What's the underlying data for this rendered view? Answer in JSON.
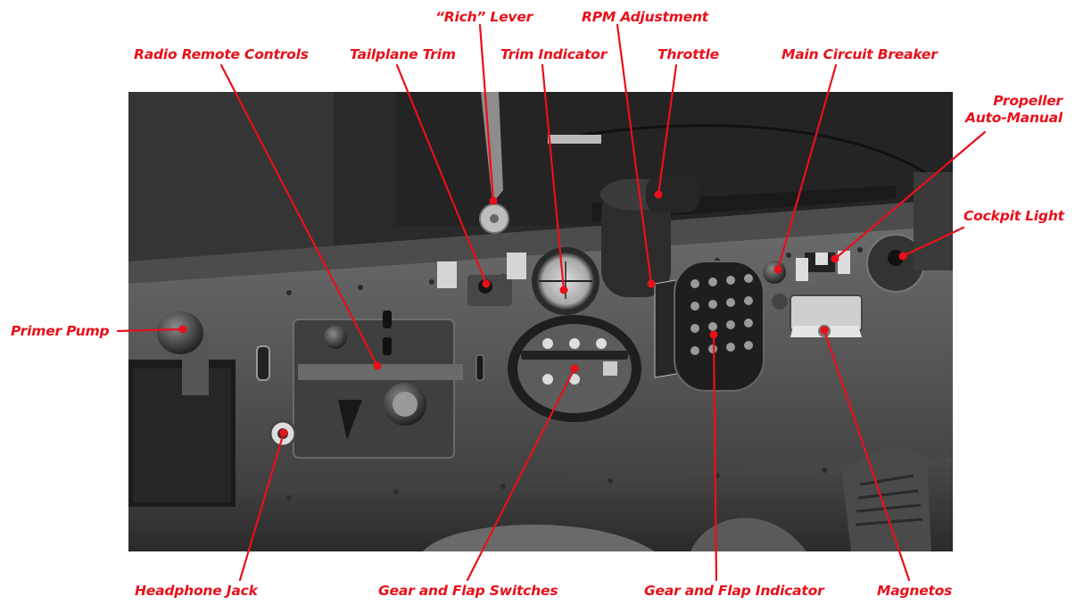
{
  "labels": {
    "rich_lever": "“Rich” Lever",
    "rpm_adjustment": "RPM Adjustment",
    "radio_remote_controls": "Radio Remote Controls",
    "tailplane_trim": "Tailplane Trim",
    "trim_indicator": "Trim Indicator",
    "throttle": "Throttle",
    "main_circuit_breaker": "Main Circuit Breaker",
    "propeller_line1": "Propeller",
    "propeller_line2": "Auto-Manual",
    "cockpit_light": "Cockpit Light",
    "primer_pump": "Primer Pump",
    "headphone_jack": "Headphone Jack",
    "gear_flap_switches": "Gear and Flap Switches",
    "gear_flap_indicator": "Gear and Flap Indicator",
    "magnetos": "Magnetos"
  },
  "colors": {
    "label": "#e8101a",
    "leader": "#e8101a"
  }
}
